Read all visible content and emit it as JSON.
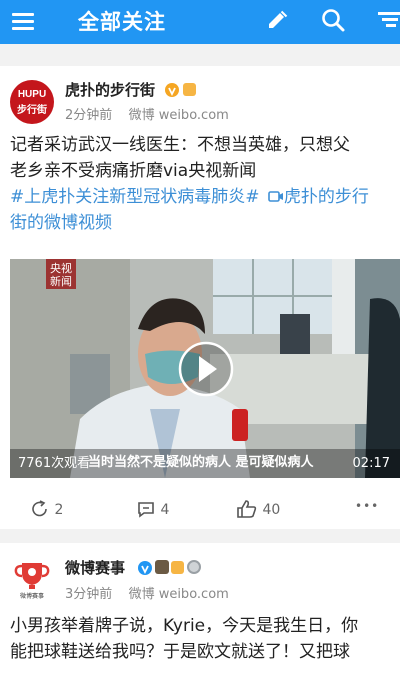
{
  "topbar": {
    "title": "全部关注",
    "icons": [
      "menu-icon",
      "edit-icon",
      "search-icon",
      "filter-icon"
    ],
    "bg": "#2196f3"
  },
  "posts": [
    {
      "avatar_text_1": "HUPU",
      "avatar_text_2": "步行街",
      "user": "虎扑的步行街",
      "time": "2分钟前",
      "source": "微博 weibo.com",
      "text_line1": "记者采访武汉一线医生：不想当英雄，只想父",
      "text_line2": "老乡亲不受病痛折磨via央视新闻",
      "hashtag": "#上虎扑关注新型冠状病毒肺炎#",
      "video_link": "虎扑的步行",
      "text_line4": "街的微博视频",
      "video": {
        "watermark_1": "央视",
        "watermark_2": "新闻",
        "views": "7761次观看",
        "subtitle": "当时当然不是疑似的病人  是可疑似病人",
        "duration": "02:17"
      },
      "reposts": "2",
      "comments": "4",
      "likes": "40",
      "more": "•••"
    },
    {
      "avatar_text": "微博赛事",
      "user": "微博赛事",
      "time": "3分钟前",
      "source": "微博 weibo.com",
      "text_line1": "小男孩举着牌子说，Kyrie，今天是我生日，你",
      "text_line2": "能把球鞋送给我吗？于是欧文就送了！又把球"
    }
  ],
  "colors": {
    "link": "#3d8fd6",
    "verified_orange": "#f5a623",
    "verified_blue": "#2196f3",
    "hupu_red": "#c4161c"
  }
}
